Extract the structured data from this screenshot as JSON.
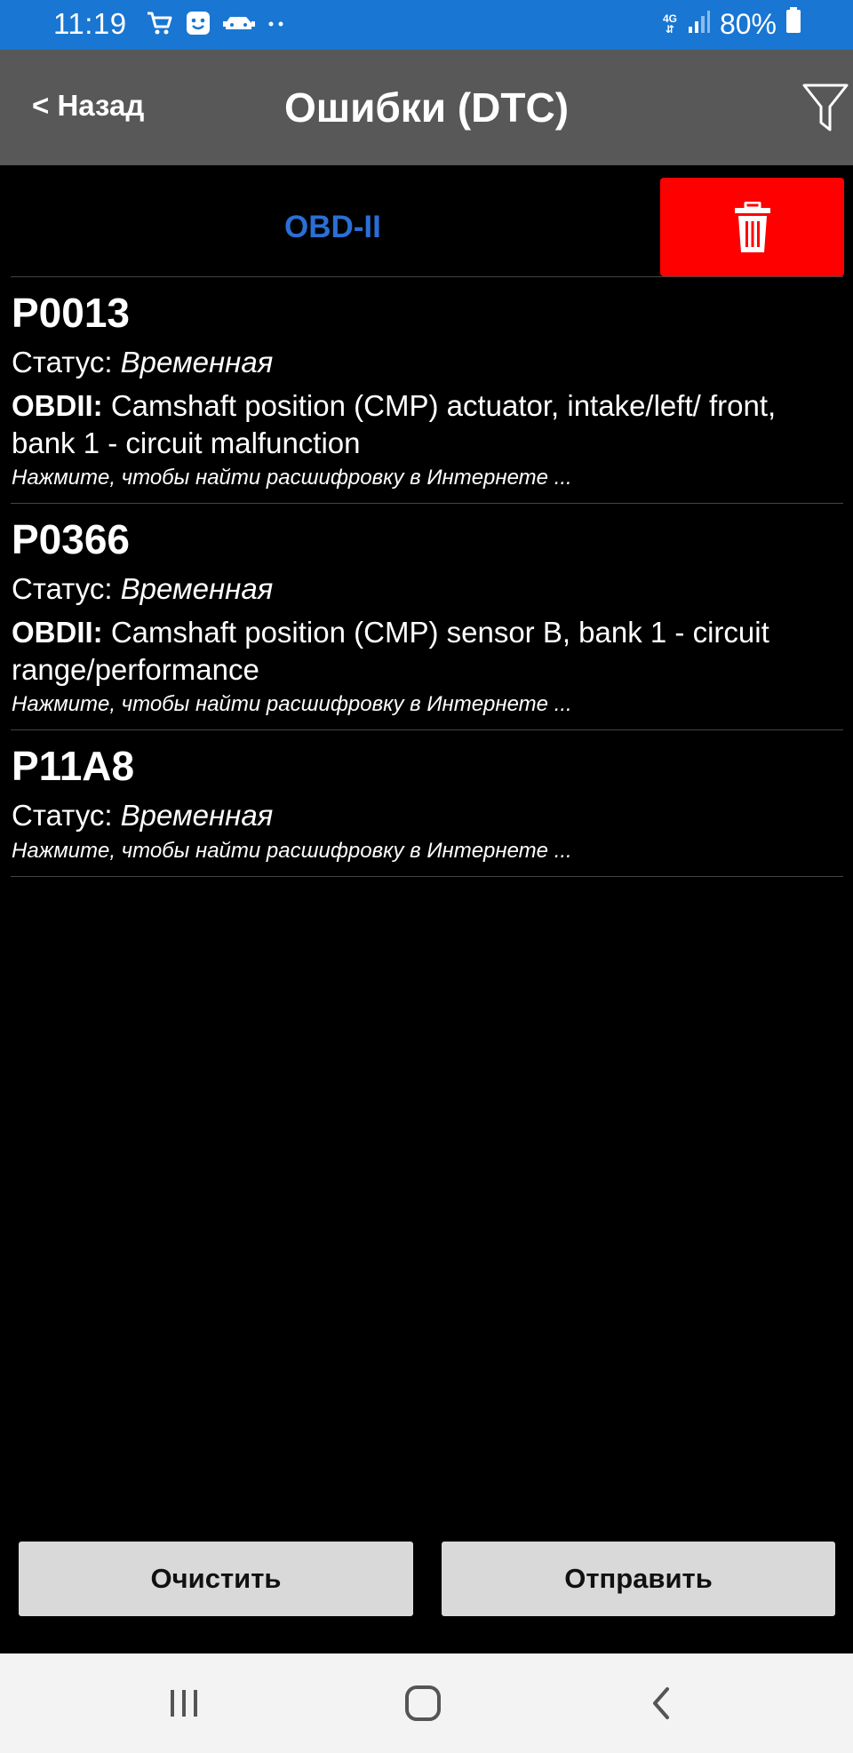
{
  "status_bar": {
    "time": "11:19",
    "network": "4G",
    "battery": "80%",
    "icons_left": [
      "cart-icon",
      "smiley-icon",
      "car-icon",
      "dots-icon"
    ],
    "icons_right": [
      "network-arrows-icon",
      "signal-icon",
      "battery-icon"
    ]
  },
  "toolbar": {
    "back_label": "< Назад",
    "title": "Ошибки (DTC)",
    "filter_icon": "filter-icon"
  },
  "source": {
    "label": "OBD-II",
    "delete_icon": "trash-icon",
    "delete_color": "#ff0000",
    "label_color": "#2a6fd6"
  },
  "dtc_items": [
    {
      "code": "P0013",
      "status_label": "Статус:",
      "status_value": "Временная",
      "desc_prefix": "OBDII:",
      "desc_text": "Camshaft position (CMP) actuator, intake/left/ front, bank 1 - circuit malfunction",
      "hint": "Нажмите, чтобы найти расшифровку в Интернете ..."
    },
    {
      "code": "P0366",
      "status_label": "Статус:",
      "status_value": "Временная",
      "desc_prefix": "OBDII:",
      "desc_text": "Camshaft position (CMP) sensor B, bank 1 - circuit range/performance",
      "hint": "Нажмите, чтобы найти расшифровку в Интернете ..."
    },
    {
      "code": "P11A8",
      "status_label": "Статус:",
      "status_value": "Временная",
      "hint": "Нажмите, чтобы найти расшифровку в Интернете ..."
    }
  ],
  "actions": {
    "clear_label": "Очистить",
    "send_label": "Отправить"
  },
  "nav_bar": {
    "icons": [
      "recents-icon",
      "home-icon",
      "back-icon"
    ]
  },
  "colors": {
    "status_bar": "#1976d2",
    "toolbar": "#585858",
    "background": "#000000",
    "button": "#d9d9d9"
  }
}
